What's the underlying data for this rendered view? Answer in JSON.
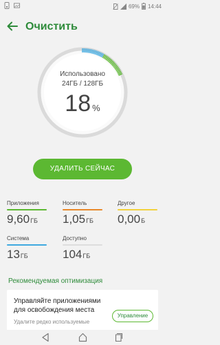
{
  "status_bar": {
    "battery": "69%",
    "time": "14:44"
  },
  "header": {
    "title": "Очистить",
    "back_icon": "arrow-left-icon"
  },
  "storage": {
    "used_label": "Использовано",
    "used_amount": "24ГБ / 128ГБ",
    "percent": "18",
    "percent_sign": "%",
    "used_fraction": 0.18,
    "colors": {
      "apps": "#5cb832",
      "media": "#e8892a",
      "other": "#f2d13c",
      "system": "#3fa9e0",
      "free": "#dddddd"
    }
  },
  "clean_button": {
    "label": "УДАЛИТЬ СЕЙЧАС"
  },
  "stats": [
    {
      "label": "Приложения",
      "value": "9,60",
      "unit": "ГБ",
      "color": "#5cb832"
    },
    {
      "label": "Носитель",
      "value": "1,05",
      "unit": "ГБ",
      "color": "#e8892a"
    },
    {
      "label": "Другое",
      "value": "0,00",
      "unit": "Б",
      "color": "#f2d13c"
    },
    {
      "label": "Система",
      "value": "13",
      "unit": "ГБ",
      "color": "#3fa9e0"
    },
    {
      "label": "Доступно",
      "value": "104",
      "unit": "ГБ",
      "color": "#dddddd"
    }
  ],
  "recommendations": {
    "section_title": "Рекомендуемая оптимизация",
    "card_title": "Управляйте приложениями для освобождения места",
    "card_subtitle": "Удалите редко используемые",
    "button_label": "Управление"
  }
}
